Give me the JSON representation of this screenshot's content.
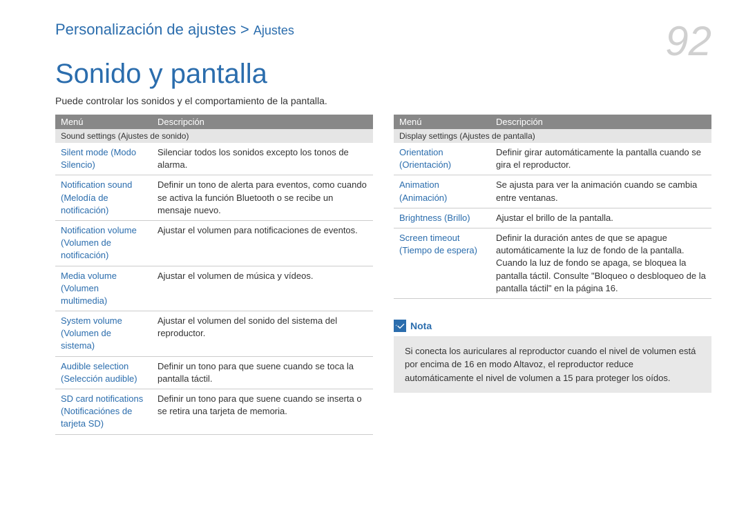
{
  "breadcrumb": {
    "parent": "Personalización de ajustes",
    "separator": ">",
    "current": "Ajustes"
  },
  "page_number": "92",
  "title": "Sonido y pantalla",
  "intro": "Puede controlar los sonidos y el comportamiento de la pantalla.",
  "table_header": {
    "menu": "Menú",
    "description": "Descripción"
  },
  "left_table": {
    "section": "Sound settings (Ajustes de sonido)",
    "rows": [
      {
        "menu": "Silent mode (Modo Silencio)",
        "desc": "Silenciar todos los sonidos excepto los tonos de alarma."
      },
      {
        "menu": "Notification sound (Melodía de notificación)",
        "desc": "Definir un tono de alerta para eventos, como cuando se activa la función Bluetooth o se recibe un mensaje nuevo."
      },
      {
        "menu": "Notification volume (Volumen de notificación)",
        "desc": "Ajustar el volumen para notificaciones de eventos."
      },
      {
        "menu": "Media volume (Volumen multimedia)",
        "desc": "Ajustar el volumen de música y vídeos."
      },
      {
        "menu": "System volume (Volumen de sistema)",
        "desc": "Ajustar el volumen del sonido del sistema del reproductor."
      },
      {
        "menu": "Audible selection (Selección audible)",
        "desc": "Definir un tono para que suene cuando se toca la pantalla táctil."
      },
      {
        "menu": "SD card notifications (Notificaciónes de tarjeta SD)",
        "desc": "Definir un tono para que suene cuando se inserta o se retira una tarjeta de memoria."
      }
    ]
  },
  "right_table": {
    "section": "Display settings (Ajustes de pantalla)",
    "rows": [
      {
        "menu": "Orientation (Orientación)",
        "desc": "Definir girar automáticamente la pantalla cuando se gira el reproductor."
      },
      {
        "menu": "Animation (Animación)",
        "desc": "Se ajusta para ver la animación cuando se cambia entre ventanas."
      },
      {
        "menu": "Brightness (Brillo)",
        "desc": "Ajustar el brillo de la pantalla."
      },
      {
        "menu": "Screen timeout (Tiempo de espera)",
        "desc": "Definir la duración antes de que se apague automáticamente la luz de fondo de la pantalla. Cuando la luz de fondo se apaga, se bloquea la pantalla táctil. Consulte \"Bloqueo o desbloqueo de la pantalla táctil\" en la página 16."
      }
    ]
  },
  "note": {
    "label": "Nota",
    "text": "Si conecta los auriculares al reproductor cuando el nivel de volumen está por encima de 16 en modo Altavoz, el reproductor reduce automáticamente el nivel de volumen a 15 para proteger los oídos."
  }
}
